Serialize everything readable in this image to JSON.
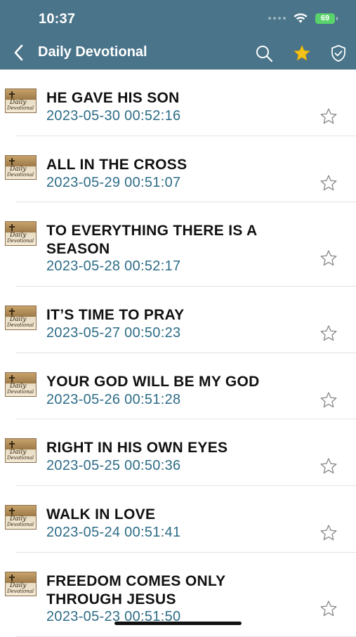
{
  "status": {
    "time": "10:37",
    "battery": "69"
  },
  "nav": {
    "title": "Daily Devotional",
    "icons": [
      "back-chevron-icon",
      "search-icon",
      "star-filled-icon",
      "shield-check-icon"
    ]
  },
  "colors": {
    "header": "#4a7489",
    "date": "#2d6c87",
    "star_filled": "#f2c21a",
    "battery": "#59d36b"
  },
  "thumbnail": {
    "line1": "Daily",
    "line2": "Devotional"
  },
  "items": [
    {
      "title": "HE GAVE HIS SON",
      "date": "2023-05-30 00:52:16"
    },
    {
      "title": "ALL IN THE CROSS",
      "date": "2023-05-29 00:51:07"
    },
    {
      "title": "TO EVERYTHING THERE IS A SEASON",
      "date": "2023-05-28 00:52:17"
    },
    {
      "title": "IT’S TIME TO PRAY",
      "date": "2023-05-27 00:50:23"
    },
    {
      "title": "YOUR GOD WILL BE MY GOD",
      "date": "2023-05-26 00:51:28"
    },
    {
      "title": "RIGHT IN HIS OWN EYES",
      "date": "2023-05-25 00:50:36"
    },
    {
      "title": "WALK IN LOVE",
      "date": "2023-05-24 00:51:41"
    },
    {
      "title": "FREEDOM COMES ONLY THROUGH JESUS",
      "date": "2023-05-23 00:51:50"
    }
  ]
}
